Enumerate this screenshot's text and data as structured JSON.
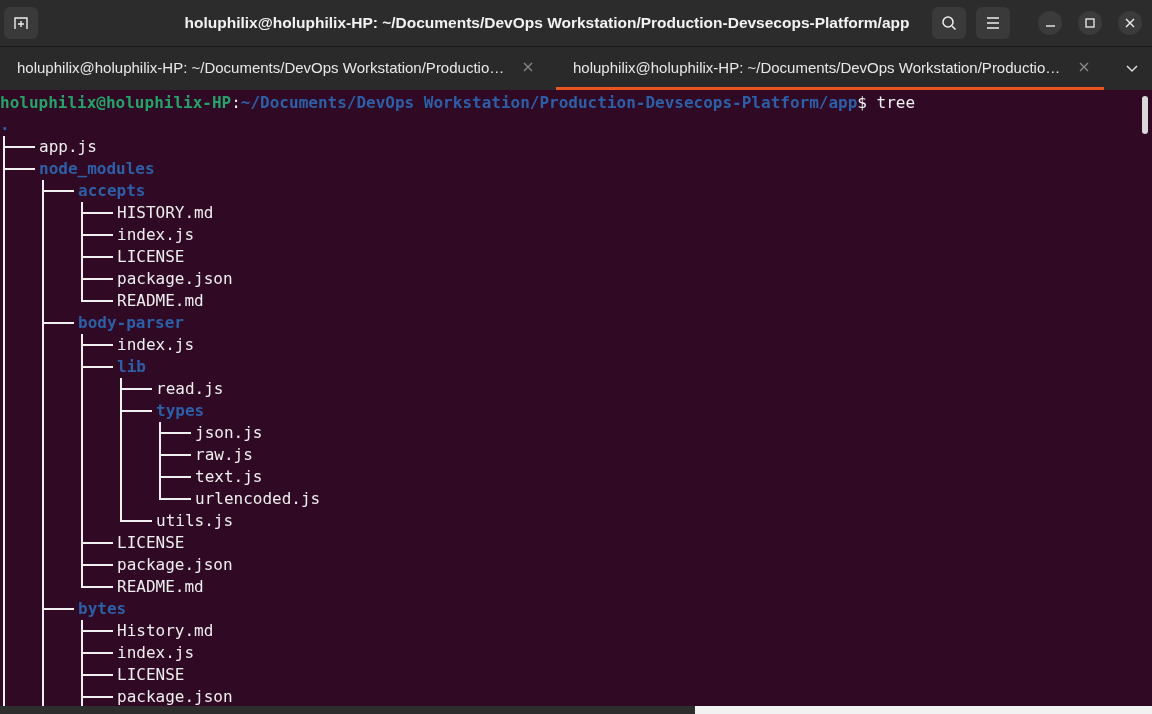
{
  "window": {
    "title": "holuphilix@holuphilix-HP: ~/Documents/DevOps Workstation/Production-Devsecops-Platform/app"
  },
  "tabs": [
    {
      "label": "holuphilix@holuphilix-HP: ~/Documents/DevOps Workstation/Productio…",
      "selected": false
    },
    {
      "label": "holuphilix@holuphilix-HP: ~/Documents/DevOps Workstation/Productio…",
      "selected": true
    }
  ],
  "prompt": {
    "user_host": "holuphilix@holuphilix-HP",
    "separator": ":",
    "path": "~/Documents/DevOps Workstation/Production-Devsecops-Platform/app",
    "symbol": "$",
    "command": "tree"
  },
  "tree": {
    "name": ".",
    "kind": "directory",
    "truncated": true,
    "children": [
      {
        "name": "app.js",
        "kind": "file"
      },
      {
        "name": "node_modules",
        "kind": "directory",
        "truncated": true,
        "children": [
          {
            "name": "accepts",
            "kind": "directory",
            "children": [
              {
                "name": "HISTORY.md",
                "kind": "file"
              },
              {
                "name": "index.js",
                "kind": "file"
              },
              {
                "name": "LICENSE",
                "kind": "file"
              },
              {
                "name": "package.json",
                "kind": "file"
              },
              {
                "name": "README.md",
                "kind": "file"
              }
            ]
          },
          {
            "name": "body-parser",
            "kind": "directory",
            "children": [
              {
                "name": "index.js",
                "kind": "file"
              },
              {
                "name": "lib",
                "kind": "directory",
                "children": [
                  {
                    "name": "read.js",
                    "kind": "file"
                  },
                  {
                    "name": "types",
                    "kind": "directory",
                    "children": [
                      {
                        "name": "json.js",
                        "kind": "file"
                      },
                      {
                        "name": "raw.js",
                        "kind": "file"
                      },
                      {
                        "name": "text.js",
                        "kind": "file"
                      },
                      {
                        "name": "urlencoded.js",
                        "kind": "file"
                      }
                    ]
                  },
                  {
                    "name": "utils.js",
                    "kind": "file"
                  }
                ]
              },
              {
                "name": "LICENSE",
                "kind": "file"
              },
              {
                "name": "package.json",
                "kind": "file"
              },
              {
                "name": "README.md",
                "kind": "file"
              }
            ]
          },
          {
            "name": "bytes",
            "kind": "directory",
            "truncated": true,
            "children": [
              {
                "name": "History.md",
                "kind": "file"
              },
              {
                "name": "index.js",
                "kind": "file"
              },
              {
                "name": "LICENSE",
                "kind": "file"
              },
              {
                "name": "package.json",
                "kind": "file"
              }
            ]
          }
        ]
      }
    ]
  }
}
